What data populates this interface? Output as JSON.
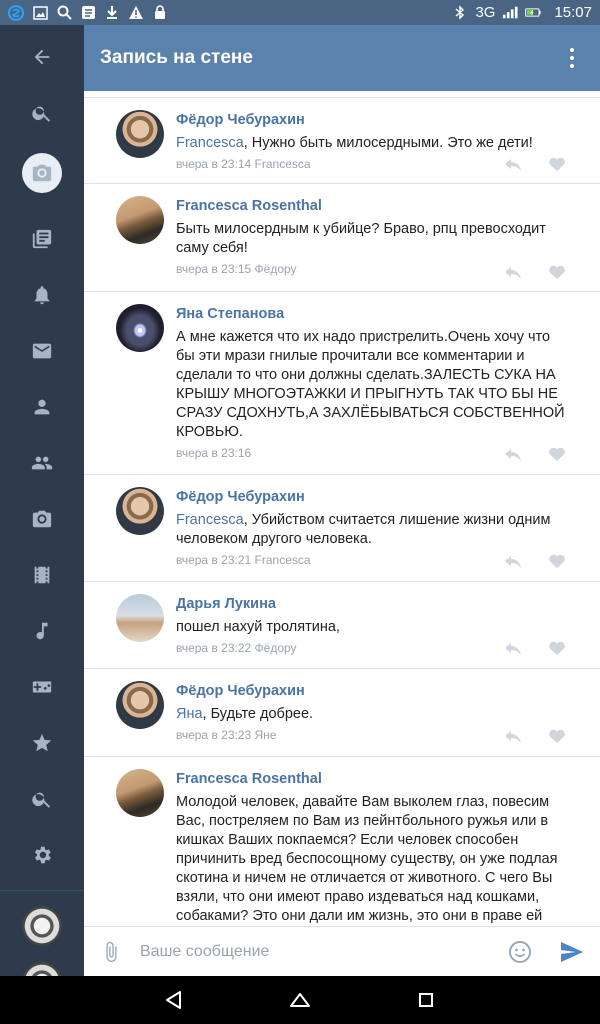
{
  "statusbar": {
    "network": "3G",
    "time": "15:07"
  },
  "header": {
    "title": "Запись на стене"
  },
  "comments": [
    {
      "name": "Фёдор Чебурахин",
      "mention": "Francesca",
      "text": ", Нужно быть милосердными. Это же дети!",
      "meta": "вчера в 23:14 Francesca"
    },
    {
      "name": "Francesca Rosenthal",
      "mention": "",
      "text": "Быть милосердным к убийце? Браво, рпц превосходит саму себя!",
      "meta": "вчера в 23:15 Фёдору"
    },
    {
      "name": "Яна Степанова",
      "mention": "",
      "text": "А мне кажется что их надо пристрелить.Очень хочу что бы эти мрази гнилые прочитали все комментарии и сделали то что они должны сделать.ЗАЛЕСТЬ  СУКА НА КРЫШУ МНОГОЭТАЖКИ И ПРЫГНУТЬ ТАК ЧТО БЫ НЕ СРАЗУ СДОХНУТЬ,А ЗАХЛЁБЫВАТЬСЯ СОБСТВЕННОЙ КРОВЬЮ.",
      "meta": "вчера в 23:16"
    },
    {
      "name": "Фёдор Чебурахин",
      "mention": "Francesca",
      "text": ", Убийством считается лишение жизни одним человеком другого человека.",
      "meta": "вчера в 23:21 Francesca"
    },
    {
      "name": "Дарья Лукина",
      "mention": "",
      "text": "пошел нахуй тролятина,",
      "meta": "вчера в 23:22 Фёдору"
    },
    {
      "name": "Фёдор Чебурахин",
      "mention": "Яна",
      "text": ", Будьте добрее.",
      "meta": "вчера в 23:23 Яне"
    },
    {
      "name": "Francesca Rosenthal",
      "mention": "",
      "text": "Молодой человек, давайте Вам выколем глаз, повесим Вас, постреляем по Вам из пейнтбольного ружья или в кишках Ваших покпаемся? Если человек способен причинить вред беспосощному существу, он уже подлая скотина и ничем не отличается от животного. С чего Вы взяли, что они имеют право издеваться над кошками, собаками? Это они дали им жизнь, это они в праве ей",
      "meta": ""
    }
  ],
  "composer": {
    "placeholder": "Ваше сообщение"
  }
}
